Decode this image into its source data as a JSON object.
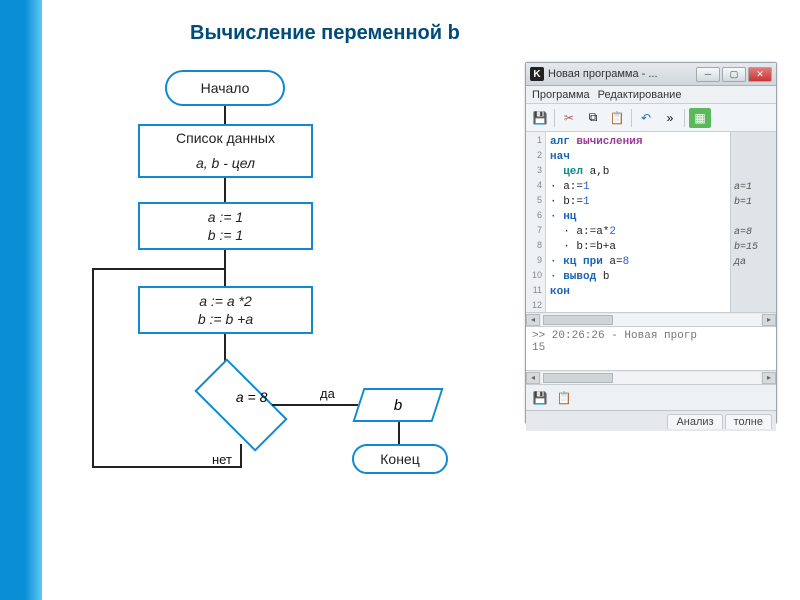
{
  "title": "Вычисление переменной b",
  "flowchart": {
    "start": "Начало",
    "data_header": "Список данных",
    "data_decl": "a, b - цел",
    "init1": "a := 1",
    "init2": "b := 1",
    "loop1": "a := a *2",
    "loop2": "b := b +a",
    "cond": "a = 8",
    "yes": "да",
    "no": "нет",
    "out": "b",
    "end": "Конец"
  },
  "ide": {
    "title": "Новая программа - ...",
    "menu": [
      "Программа",
      "Редактирование"
    ],
    "code_lines": [
      {
        "text_parts": [
          {
            "t": "алг ",
            "c": "kw-blue"
          },
          {
            "t": "вычисления",
            "c": "kw-purple"
          }
        ]
      },
      {
        "text_parts": [
          {
            "t": "нач",
            "c": "kw-blue"
          }
        ]
      },
      {
        "text_parts": [
          {
            "t": "  цел ",
            "c": "kw-teal"
          },
          {
            "t": "a,b",
            "c": "op"
          }
        ]
      },
      {
        "text_parts": [
          {
            "t": "· a:=",
            "c": "op"
          },
          {
            "t": "1",
            "c": "num"
          }
        ]
      },
      {
        "text_parts": [
          {
            "t": "· b:=",
            "c": "op"
          },
          {
            "t": "1",
            "c": "num"
          }
        ]
      },
      {
        "text_parts": [
          {
            "t": "· нц",
            "c": "kw-blue"
          }
        ]
      },
      {
        "text_parts": [
          {
            "t": "  · a:=a*",
            "c": "op"
          },
          {
            "t": "2",
            "c": "num"
          }
        ]
      },
      {
        "text_parts": [
          {
            "t": "  · b:=b+a",
            "c": "op"
          }
        ]
      },
      {
        "text_parts": [
          {
            "t": "· кц при ",
            "c": "kw-blue"
          },
          {
            "t": "a=",
            "c": "op"
          },
          {
            "t": "8",
            "c": "num"
          }
        ]
      },
      {
        "text_parts": [
          {
            "t": "· вывод ",
            "c": "kw-blue"
          },
          {
            "t": "b",
            "c": "op"
          }
        ]
      },
      {
        "text_parts": [
          {
            "t": "кон",
            "c": "kw-blue"
          }
        ]
      },
      {
        "text_parts": []
      }
    ],
    "right_col": [
      "",
      "",
      "",
      "a=1",
      "b=1",
      "",
      "a=8",
      "b=15",
      "да",
      "",
      ""
    ],
    "console_time": ">> 20:26:26 - Новая прогр",
    "console_out": "15",
    "tabs": [
      "Анализ",
      "толне"
    ]
  }
}
